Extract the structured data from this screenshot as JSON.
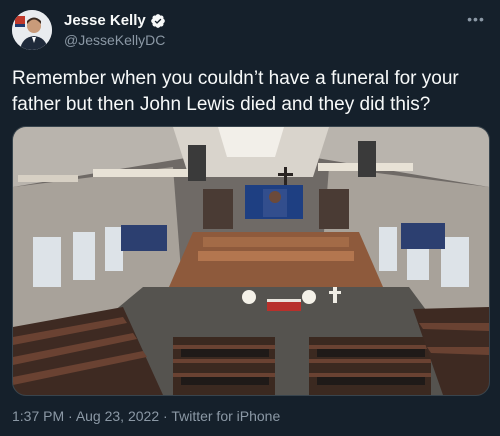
{
  "author": {
    "display_name": "Jesse Kelly",
    "handle": "@JesseKellyDC"
  },
  "tweet": {
    "text": "Remember when you couldn’t have a funeral for your father but then John Lewis died and they did this?"
  },
  "meta": {
    "time": "1:37 PM",
    "separator1": " · ",
    "date": "Aug 23, 2022",
    "separator2": " · ",
    "source": "Twitter for iPhone"
  },
  "icons": {
    "verified": "verified-badge-icon",
    "more": "more-options-icon"
  },
  "colors": {
    "background": "#15202b",
    "text": "#f7f9f9",
    "secondary": "#8b98a5",
    "verified": "#1d9bf0"
  }
}
